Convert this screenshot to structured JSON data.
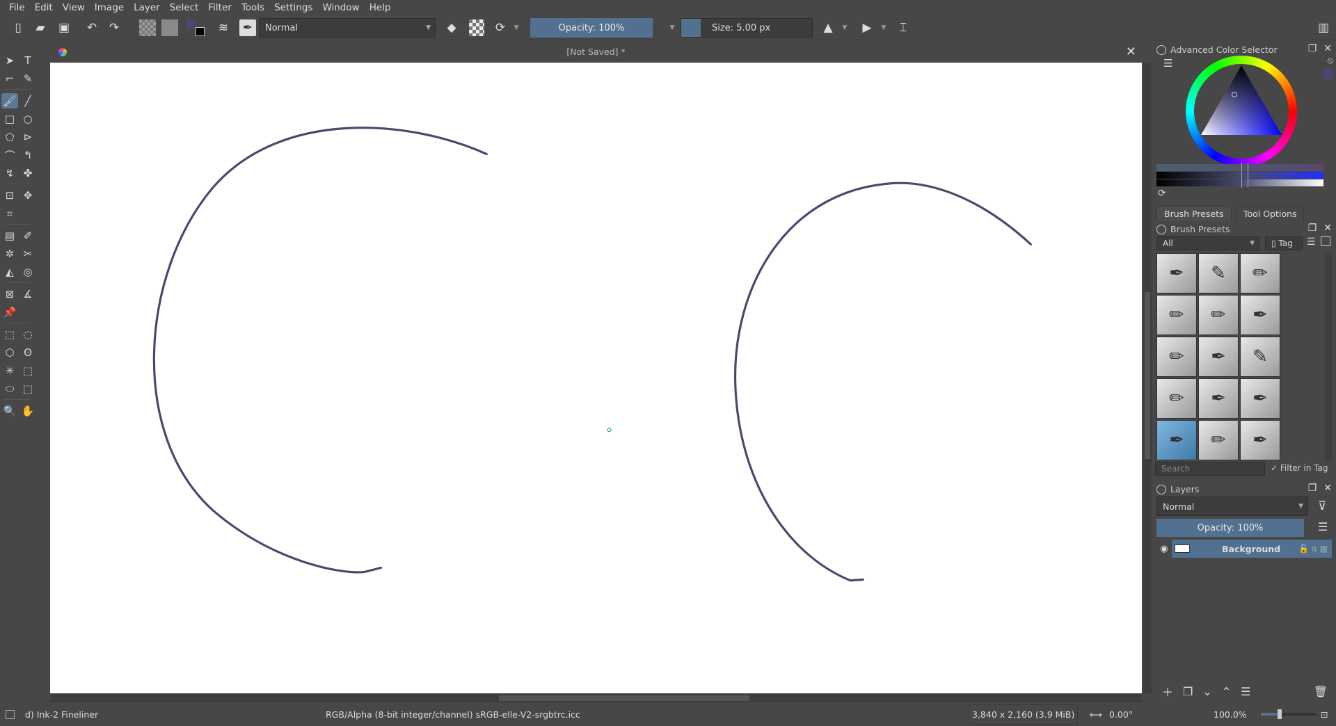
{
  "menu": [
    "File",
    "Edit",
    "View",
    "Image",
    "Layer",
    "Select",
    "Filter",
    "Tools",
    "Settings",
    "Window",
    "Help"
  ],
  "toolbar": {
    "blend_mode": "Normal",
    "opacity": "Opacity: 100%",
    "size": "Size: 5.00 px"
  },
  "document": {
    "title": "[Not Saved]  *"
  },
  "color_selector": {
    "title": "Advanced Color Selector",
    "current_color": "#474a6e"
  },
  "dock_tabs": [
    "Brush Presets",
    "Tool Options"
  ],
  "brush_presets": {
    "title": "Brush Presets",
    "filter": "All",
    "tag": "Tag",
    "search_placeholder": "Search",
    "filter_in_tag": "Filter in Tag",
    "count": 15,
    "selected_index": 12
  },
  "layers": {
    "title": "Layers",
    "blend_mode": "Normal",
    "opacity": "Opacity:  100%",
    "items": [
      {
        "name": "Background",
        "visible": true
      }
    ]
  },
  "status": {
    "brush": "d) Ink-2 Fineliner",
    "color_space": "RGB/Alpha (8-bit integer/channel)  sRGB-elle-V2-srgbtrc.icc",
    "dimensions": "3,840 x 2,160 (3.9 MiB)",
    "rotation": "0.00°",
    "zoom": "100.0%"
  },
  "colors": {
    "accent": "#52708f",
    "stroke": "#474a6e",
    "bg": "#474747"
  }
}
